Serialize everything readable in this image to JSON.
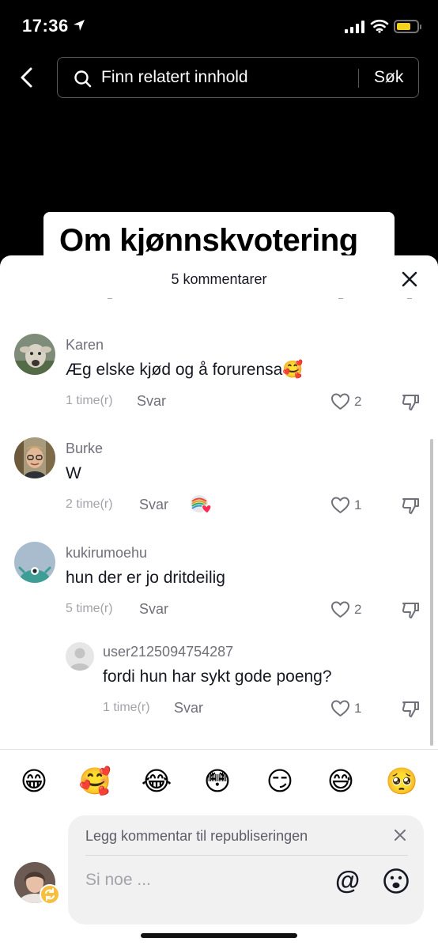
{
  "status_bar": {
    "time": "17:36"
  },
  "header": {
    "search_placeholder": "Finn relatert innhold",
    "search_button": "Søk"
  },
  "video": {
    "title_text": "Om kjønnskvotering"
  },
  "comments_sheet": {
    "title": "5 kommentarer",
    "comments": [
      {
        "user": "Karen",
        "text": "Æg elske kjød og å forurensa🥰",
        "time": "1 time(r)",
        "reply": "Svar",
        "likes": "2"
      },
      {
        "user": "Burke",
        "text": "W",
        "time": "2 time(r)",
        "reply": "Svar",
        "likes": "1"
      },
      {
        "user": "kukirumoehu",
        "text": "hun der er jo dritdeilig",
        "time": "5 time(r)",
        "reply": "Svar",
        "likes": "2"
      },
      {
        "user": "user2125094754287",
        "text": "fordi hun har sykt gode poeng?",
        "time": "1 time(r)",
        "reply": "Svar",
        "likes": "1"
      }
    ],
    "quick_emojis": [
      "😁",
      "🥰",
      "😂",
      "😳",
      "😏",
      "😅",
      "🥺"
    ],
    "composer": {
      "repost_label": "Legg kommentar til republiseringen",
      "input_placeholder": "Si noe ...",
      "mention": "@"
    }
  }
}
